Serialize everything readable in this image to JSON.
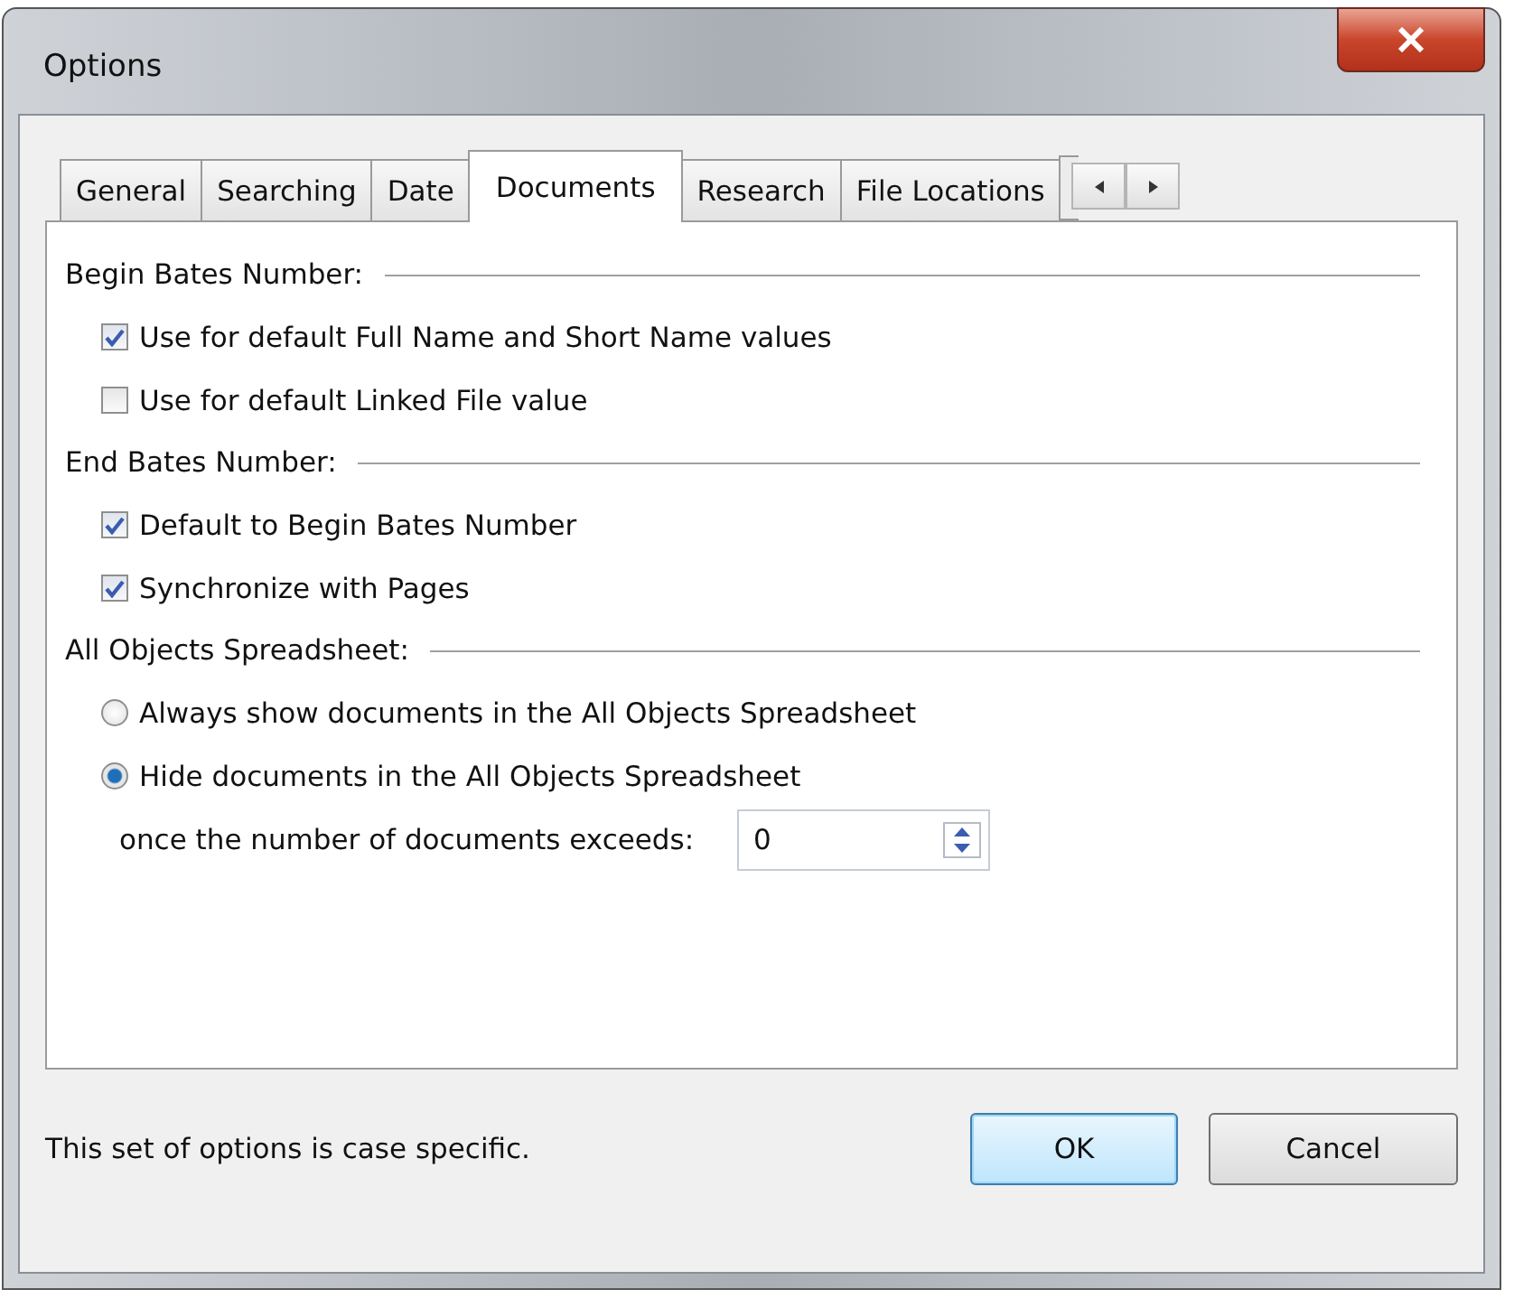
{
  "window": {
    "title": "Options"
  },
  "tabs": [
    {
      "label": "General",
      "selected": false
    },
    {
      "label": "Searching",
      "selected": false
    },
    {
      "label": "Date",
      "selected": false
    },
    {
      "label": "Documents",
      "selected": true
    },
    {
      "label": "Research",
      "selected": false
    },
    {
      "label": "File Locations",
      "selected": false
    }
  ],
  "sections": [
    {
      "title": "Begin Bates Number:",
      "items": [
        {
          "kind": "checkbox",
          "label": "Use for default Full Name and Short Name values",
          "checked": true
        },
        {
          "kind": "checkbox",
          "label": "Use for default Linked File value",
          "checked": false
        }
      ]
    },
    {
      "title": "End Bates Number:",
      "items": [
        {
          "kind": "checkbox",
          "label": "Default to Begin Bates Number",
          "checked": true
        },
        {
          "kind": "checkbox",
          "label": "Synchronize with Pages",
          "checked": true
        }
      ]
    },
    {
      "title": "All Objects Spreadsheet:",
      "items": [
        {
          "kind": "radio",
          "label": "Always show documents in the All Objects Spreadsheet",
          "selected": false
        },
        {
          "kind": "radio",
          "label": "Hide documents in the All Objects Spreadsheet",
          "selected": true
        },
        {
          "kind": "spinner",
          "label": "once the number of documents exceeds:",
          "value": "0"
        }
      ]
    }
  ],
  "footer_note": "This set of options is case specific.",
  "buttons": [
    "OK",
    "Cancel"
  ]
}
